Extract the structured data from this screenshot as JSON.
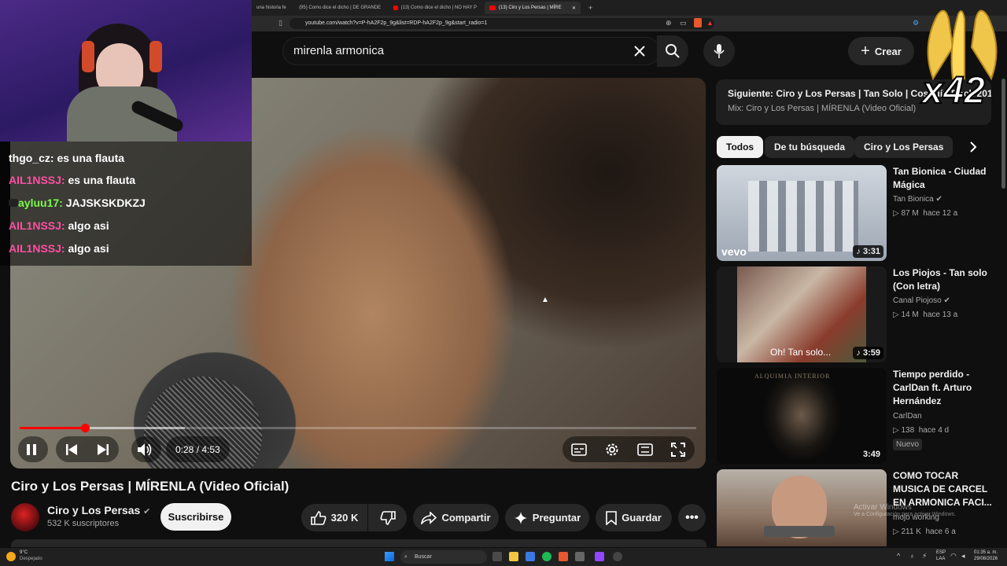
{
  "browser": {
    "tabs": [
      "una historia fe",
      "(95) Como dice el dicho | DE GRANDE",
      "(13) Como dice el dicho | NO HAY P",
      "(13) Ciro y Los Persas | MÍRE"
    ],
    "url": "youtube.com/watch?v=P-hA2F2p_9g&list=RDP-hA2F2p_9g&start_radio=1"
  },
  "header": {
    "search_value": "mirenla armonica",
    "create_label": "Crear"
  },
  "chat": [
    {
      "user": "thgo_cz:",
      "text": "es una flauta",
      "color": "#ffffff"
    },
    {
      "user": "AIL1NSSJ:",
      "text": "es una flauta",
      "color": "#ff4fa3"
    },
    {
      "user": "ayluu17:",
      "text": "JAJSKSKDKZJ",
      "color": "#7cfc4c"
    },
    {
      "user": "AIL1NSSJ:",
      "text": "algo asi",
      "color": "#ff4fa3"
    },
    {
      "user": "AIL1NSSJ:",
      "text": "algo asi",
      "color": "#ff4fa3"
    }
  ],
  "overlay": {
    "multiplier": "x42"
  },
  "player": {
    "time": "0:28 / 4:53",
    "progress_fraction": 0.097
  },
  "video": {
    "title": "Ciro y Los Persas | MÍRENLA (Video Oficial)",
    "channel": "Ciro y Los Persas",
    "subscribers": "532 K suscriptores",
    "subscribe_label": "Suscribirse",
    "likes": "320 K",
    "share_label": "Compartir",
    "ask_label": "Preguntar",
    "save_label": "Guardar"
  },
  "sidebar": {
    "up_next_title": "Siguiente: Ciro y Los Persas | Tan Solo | Cosquín Rock 2018",
    "up_next_sub": "Mix: Ciro y Los Persas | MÍRENLA (Video Oficial)",
    "chips": [
      "Todos",
      "De tu búsqueda",
      "Ciro y Los Persas"
    ],
    "videos": [
      {
        "title": "Tan Bionica - Ciudad Mágica",
        "channel": "Tan Bionica",
        "views": "87 M",
        "age": "hace 12 a",
        "duration": "3:31",
        "thumb_text": "vevo"
      },
      {
        "title": "Los Piojos - Tan solo (Con letra)",
        "channel": "Canal Piojoso",
        "views": "14 M",
        "age": "hace 13 a",
        "duration": "3:59",
        "thumb_text": "Oh! Tan solo..."
      },
      {
        "title": "Tiempo perdido - CarlDan ft. Arturo Hernández",
        "channel": "CarlDan",
        "views": "138",
        "age": "hace 4 d",
        "duration": "3:49",
        "badge": "Nuevo",
        "thumb_text": "ALQUIMIA INTERIOR"
      },
      {
        "title": "COMO TOCAR MUSICA DE CARCEL EN ARMONICA FACI...",
        "channel": "mojo working",
        "views": "211 K",
        "age": "hace 6 a"
      }
    ]
  },
  "watermark": {
    "line1": "Activar Windows",
    "line2": "Ve a Configuración para activar Windows."
  },
  "taskbar": {
    "weather_temp": "9°C",
    "weather_desc": "Despejado",
    "search_label": "Buscar",
    "lang1": "ESP",
    "lang2": "LAA",
    "time": "01:35 a. m.",
    "date": "29/08/2026"
  }
}
